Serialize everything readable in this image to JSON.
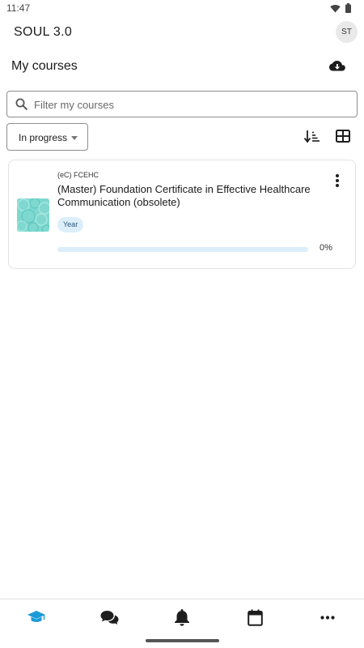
{
  "status_bar": {
    "time": "11:47",
    "icons": [
      "wifi-icon",
      "battery-icon"
    ]
  },
  "app_bar": {
    "title": "SOUL 3.0",
    "avatar_initials": "ST"
  },
  "page": {
    "title": "My courses",
    "download_icon": "cloud-download-icon"
  },
  "search": {
    "placeholder": "Filter my courses",
    "value": ""
  },
  "filter": {
    "selected": "In progress"
  },
  "view_controls": {
    "sort_icon": "sort-icon",
    "grid_icon": "grid-view-icon"
  },
  "courses": [
    {
      "code": "(eC) FCEHC",
      "name": "(Master) Foundation Certificate in Effective Healthcare Communication (obsolete)",
      "tag": "Year",
      "progress": 0,
      "progress_label": "0%"
    }
  ],
  "bottom_nav": {
    "items": [
      {
        "icon": "graduation-cap-icon",
        "active": true
      },
      {
        "icon": "chat-icon",
        "active": false
      },
      {
        "icon": "bell-icon",
        "active": false
      },
      {
        "icon": "calendar-icon",
        "active": false
      },
      {
        "icon": "more-icon",
        "active": false
      }
    ]
  },
  "colors": {
    "accent": "#1a9bd7",
    "tag_bg": "#dceef9",
    "thumb": "#7fd8d0"
  }
}
